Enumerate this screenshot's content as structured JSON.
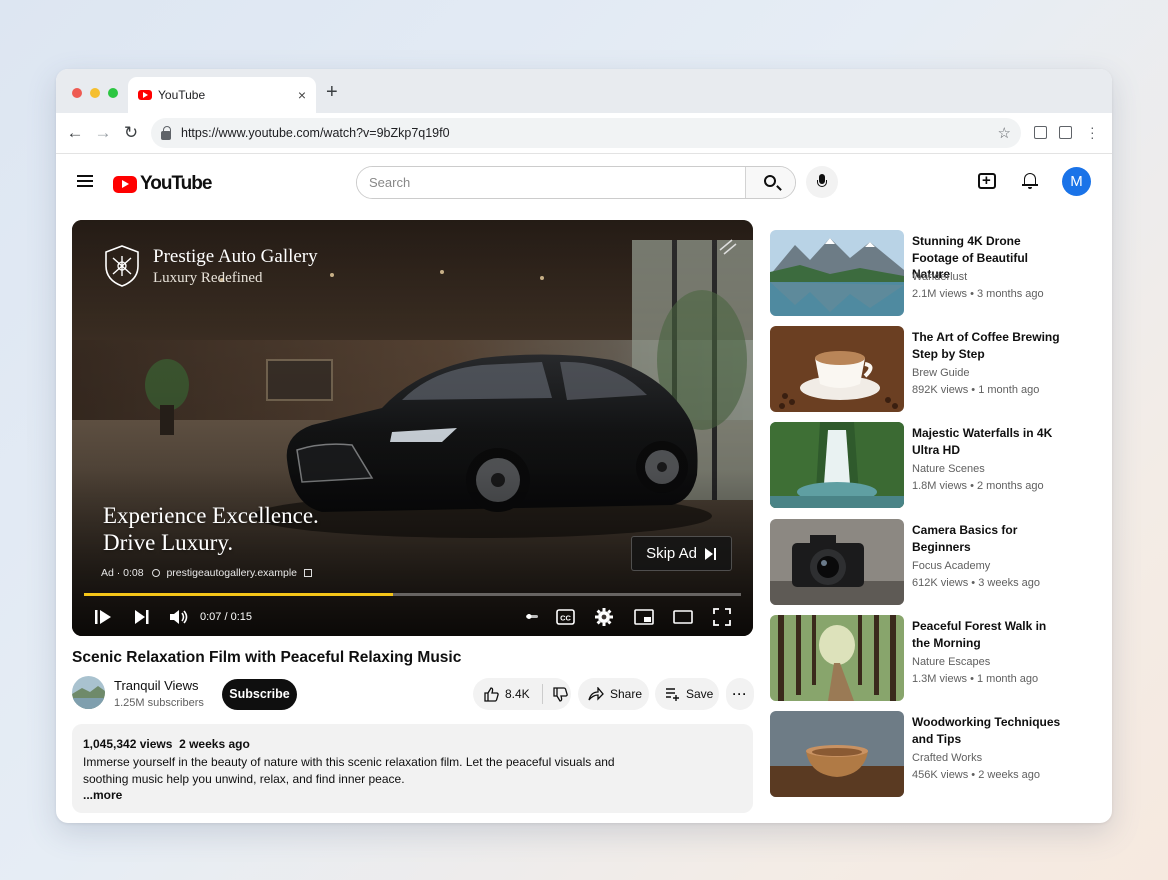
{
  "browser": {
    "tab_title": "YouTube",
    "tab_close": "×",
    "new_tab": "+",
    "url": "https://www.youtube.com/watch?v=9bZkp7q19f0",
    "traffic_lights": [
      "#ee5a52",
      "#f5bf2f",
      "#2cc641"
    ]
  },
  "header": {
    "logo_text": "YouTube",
    "search_placeholder": "Search",
    "avatar_letter": "M",
    "avatar_color": "#1a73e8"
  },
  "player": {
    "advertiser": "Prestige Auto Gallery",
    "advertiser_tagline": "Luxury Redefined",
    "ad_line1": "Experience Excellence.",
    "ad_line2": "Drive Luxury.",
    "ad_label": "Ad · 0:08",
    "ad_domain": "prestigeautogallery.example",
    "skip_label": "Skip Ad",
    "time": "0:07 / 0:15",
    "progress": 0.47,
    "progress_color": "#f5c518"
  },
  "video": {
    "title": "Scenic Relaxation Film with Peaceful Relaxing Music",
    "channel": "Tranquil Views",
    "subscribers": "1.25M subscribers",
    "subscribe_label": "Subscribe",
    "likes": "8.4K",
    "share_label": "Share",
    "save_label": "Save",
    "stats": "1,045,342 views  2 weeks ago",
    "description": "Immerse yourself in the beauty of nature with this scenic relaxation film. Let the peaceful visuals and soothing music help you unwind, relax, and find inner peace.",
    "more_label": "...more"
  },
  "recommendations": [
    {
      "title": "Stunning 4K Drone Footage of Beautiful Nature",
      "channel": "Wanderlust",
      "meta": "2.1M views • 3 months ago",
      "thumb": "mountain-lake"
    },
    {
      "title": "The Art of Coffee Brewing Step by Step",
      "channel": "Brew Guide",
      "meta": "892K views • 1 month ago",
      "thumb": "coffee-cup"
    },
    {
      "title": "Majestic Waterfalls in 4K Ultra HD",
      "channel": "Nature Scenes",
      "meta": "1.8M views • 2 months ago",
      "thumb": "waterfall"
    },
    {
      "title": "Camera Basics for Beginners",
      "channel": "Focus Academy",
      "meta": "612K views • 3 weeks ago",
      "thumb": "camera"
    },
    {
      "title": "Peaceful Forest Walk in the Morning",
      "channel": "Nature Escapes",
      "meta": "1.3M views • 1 month ago",
      "thumb": "forest-path"
    },
    {
      "title": "Woodworking Techniques and Tips",
      "channel": "Crafted Works",
      "meta": "456K views • 2 weeks ago",
      "thumb": "wooden-bowl"
    }
  ]
}
